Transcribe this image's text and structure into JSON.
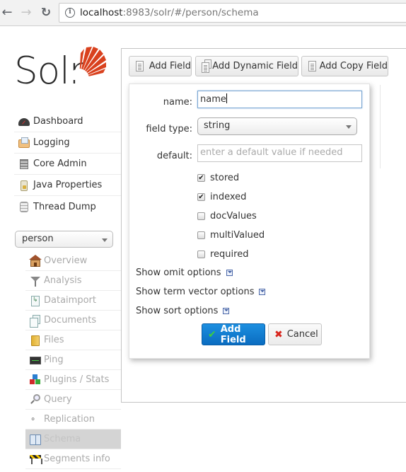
{
  "browser": {
    "url_host": "localhost",
    "url_rest": ":8983/solr/#/person/schema",
    "back_icon": "arrow-left-icon",
    "forward_icon": "arrow-right-icon",
    "reload_icon": "reload-icon",
    "info_icon": "info-icon"
  },
  "logo": {
    "text": "Solr",
    "accent_color": "#d9411e"
  },
  "sidebar": {
    "items": [
      {
        "label": "Dashboard",
        "icon": "dashboard-icon"
      },
      {
        "label": "Logging",
        "icon": "logging-icon"
      },
      {
        "label": "Core Admin",
        "icon": "core-admin-icon"
      },
      {
        "label": "Java Properties",
        "icon": "java-properties-icon"
      },
      {
        "label": "Thread Dump",
        "icon": "thread-dump-icon"
      }
    ],
    "core_selector": {
      "selected": "person"
    },
    "core_items": [
      {
        "label": "Overview",
        "icon": "home-icon"
      },
      {
        "label": "Analysis",
        "icon": "funnel-icon"
      },
      {
        "label": "Dataimport",
        "icon": "dataimport-icon"
      },
      {
        "label": "Documents",
        "icon": "documents-icon"
      },
      {
        "label": "Files",
        "icon": "folder-icon"
      },
      {
        "label": "Ping",
        "icon": "ping-icon"
      },
      {
        "label": "Plugins / Stats",
        "icon": "plugins-icon"
      },
      {
        "label": "Query",
        "icon": "magnifier-icon"
      },
      {
        "label": "Replication",
        "icon": "replication-icon"
      },
      {
        "label": "Schema",
        "icon": "schema-book-icon",
        "active": true
      },
      {
        "label": "Segments info",
        "icon": "segments-icon"
      }
    ]
  },
  "toolbar": {
    "add_field": "Add Field",
    "add_dynamic_field": "Add Dynamic Field",
    "add_copy_field": "Add Copy Field"
  },
  "form": {
    "name_label": "name:",
    "name_value": "name",
    "field_type_label": "field type:",
    "field_type_value": "string",
    "default_label": "default:",
    "default_placeholder": "enter a default value if needed",
    "checkboxes": [
      {
        "label": "stored",
        "checked": true
      },
      {
        "label": "indexed",
        "checked": true
      },
      {
        "label": "docValues",
        "checked": false
      },
      {
        "label": "multiValued",
        "checked": false
      },
      {
        "label": "required",
        "checked": false
      }
    ],
    "options": [
      {
        "label": "Show omit options"
      },
      {
        "label": "Show term vector options"
      },
      {
        "label": "Show sort options"
      }
    ],
    "submit_label": "Add Field",
    "cancel_label": "Cancel",
    "submit_color": "#0a6cc0"
  }
}
